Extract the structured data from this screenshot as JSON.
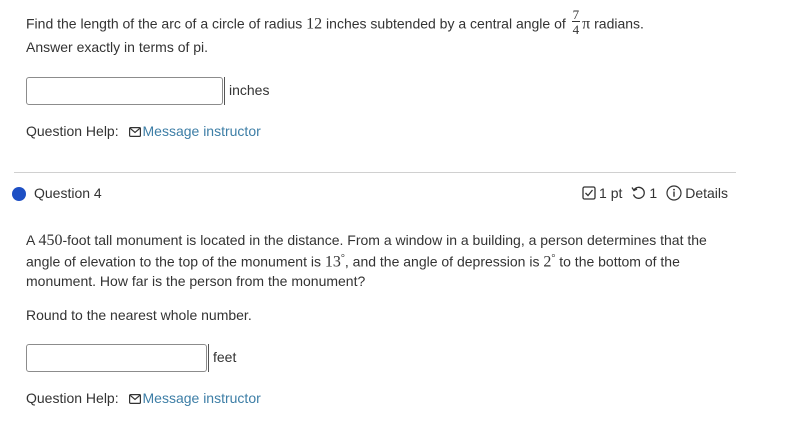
{
  "question3": {
    "prompt_before_radius": "Find the length of the arc of a circle of radius ",
    "radius": "12",
    "prompt_middle": " inches subtended by a central angle of ",
    "frac_num": "7",
    "frac_den": "4",
    "pi": "π",
    "prompt_end": " radians.",
    "answer_note": "Answer exactly in terms of pi.",
    "input_value": "",
    "unit": "inches",
    "help_label": "Question Help:",
    "message_link": "Message instructor"
  },
  "question4": {
    "title": "Question 4",
    "points": "1 pt",
    "attempts": "1",
    "details": "Details",
    "text_1": "A ",
    "height": "450",
    "text_2": "-foot tall monument is located in the distance. From a window in a building, a person determines that the angle of elevation to the top of the monument is ",
    "elev": "13",
    "deg": "°",
    "text_3": ", and the angle of depression is ",
    "depr": "2",
    "text_4": " to the bottom of the monument. How far is the person from the monument?",
    "round_note": "Round to the nearest whole number.",
    "input_value": "",
    "unit": "feet",
    "help_label": "Question Help:",
    "message_link": "Message instructor"
  },
  "colors": {
    "link": "#3d7ea6",
    "dot": "#1d4fc4"
  },
  "icons": [
    "mail-icon",
    "checkbox-icon",
    "retry-icon",
    "info-icon"
  ]
}
